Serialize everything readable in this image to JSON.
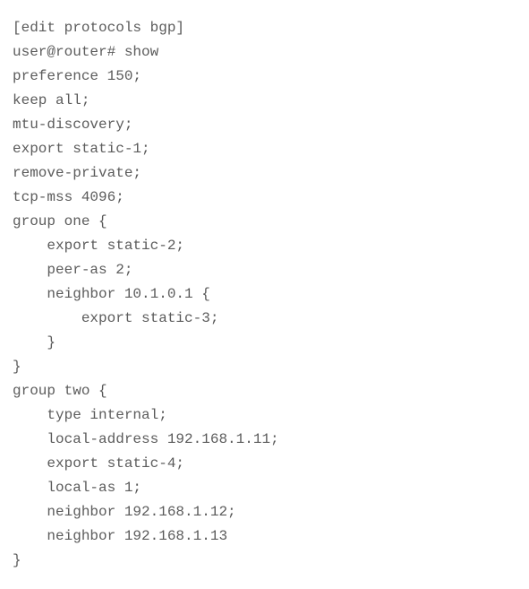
{
  "cli": {
    "context": "[edit protocols bgp]",
    "prompt": "user@router# show",
    "lines": [
      "preference 150;",
      "keep all;",
      "mtu-discovery;",
      "export static-1;",
      "remove-private;",
      "tcp-mss 4096;",
      "group one {",
      "    export static-2;",
      "    peer-as 2;",
      "    neighbor 10.1.0.1 {",
      "        export static-3;",
      "    }",
      "}",
      "group two {",
      "    type internal;",
      "    local-address 192.168.1.11;",
      "    export static-4;",
      "    local-as 1;",
      "    neighbor 192.168.1.12;",
      "    neighbor 192.168.1.13",
      "}"
    ]
  }
}
